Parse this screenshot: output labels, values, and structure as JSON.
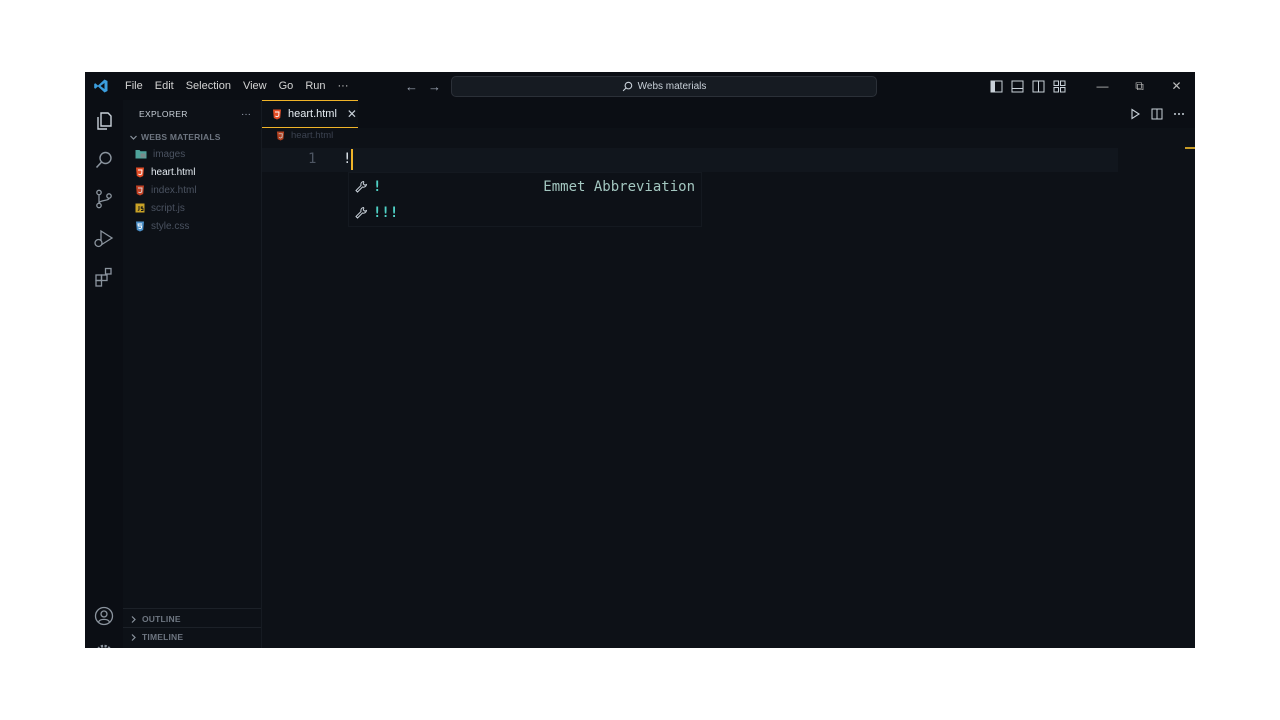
{
  "titlebar": {
    "menu": [
      "File",
      "Edit",
      "Selection",
      "View",
      "Go",
      "Run",
      "···"
    ],
    "nav_back": "←",
    "nav_forward": "→",
    "search_text": "Webs materials",
    "minimize": "—",
    "restore": "⧉",
    "close": "✕"
  },
  "activitybar": {
    "icons": [
      "explorer-icon",
      "search-icon",
      "source-control-icon",
      "run-debug-icon",
      "extensions-icon",
      "accounts-icon",
      "manage-gear-icon"
    ]
  },
  "sidebar": {
    "title": "EXPLORER",
    "more": "···",
    "folder": "WEBS MATERIALS",
    "files": [
      {
        "name": "images",
        "type": "folder"
      },
      {
        "name": "heart.html",
        "type": "html",
        "active": true
      },
      {
        "name": "index.html",
        "type": "html"
      },
      {
        "name": "script.js",
        "type": "js"
      },
      {
        "name": "style.css",
        "type": "css"
      }
    ],
    "outline": "OUTLINE",
    "timeline": "TIMELINE"
  },
  "editor": {
    "tab_label": "heart.html",
    "tab_close": "✕",
    "breadcrumb": "heart.html",
    "line_number": "1",
    "line_text": "!",
    "suggestions": [
      {
        "label": "!",
        "detail": "Emmet Abbreviation"
      },
      {
        "label": "!!!",
        "detail": ""
      }
    ]
  },
  "colors": {
    "background": "#0d1117",
    "accent": "#f0b429",
    "html_icon": "#e44d26",
    "suggest_text": "#4fd1c5"
  }
}
